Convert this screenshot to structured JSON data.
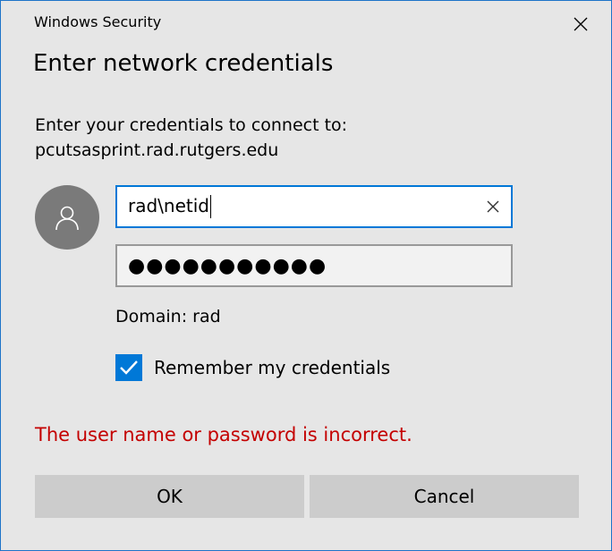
{
  "window": {
    "title": "Windows Security",
    "border_color": "#1e73c8"
  },
  "dialog": {
    "heading": "Enter network credentials",
    "prompt_line1": "Enter your credentials to connect to:",
    "prompt_line2": "pcutsasprint.rad.rutgers.edu"
  },
  "user": {
    "avatar_icon": "user-silhouette-icon"
  },
  "username": {
    "value": "rad\\netid",
    "clear_icon": "close-icon"
  },
  "password": {
    "masked_value": "●●●●●●●●●●●"
  },
  "domain": {
    "text": "Domain: rad"
  },
  "remember": {
    "label": "Remember my credentials",
    "checked": true,
    "accent": "#0078d7"
  },
  "error": {
    "message": "The user name or password is incorrect.",
    "color": "#c40000"
  },
  "buttons": {
    "ok_label": "OK",
    "cancel_label": "Cancel"
  }
}
